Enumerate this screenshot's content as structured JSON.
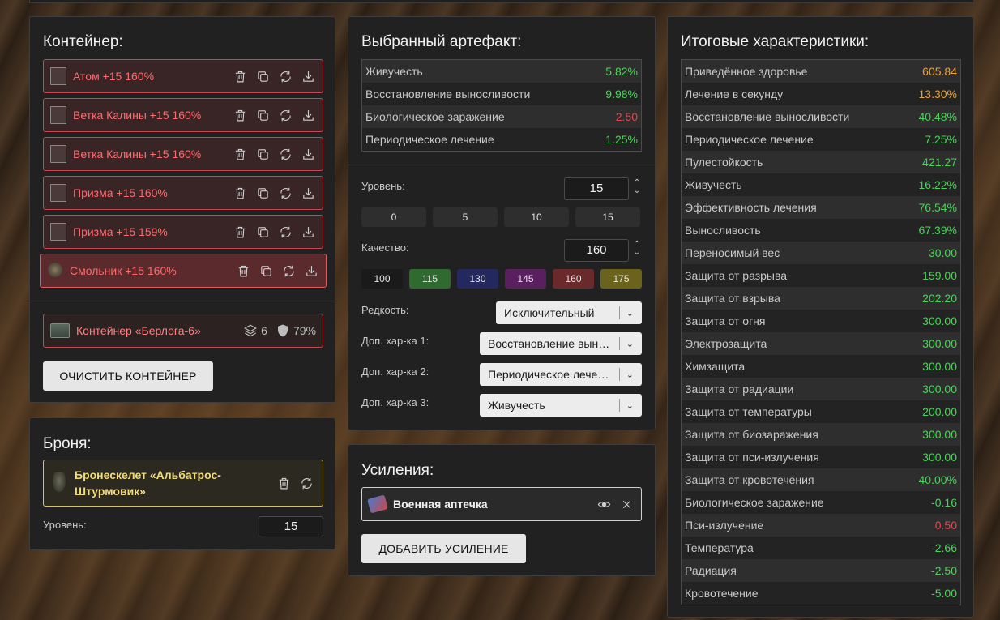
{
  "container": {
    "title": "Контейнер:",
    "artifacts": [
      {
        "name": "Атом +15 160%"
      },
      {
        "name": "Ветка Калины +15 160%"
      },
      {
        "name": "Ветка Калины +15 160%"
      },
      {
        "name": "Призма +15 160%"
      },
      {
        "name": "Призма +15 159%"
      },
      {
        "name": "Смольник +15 160%"
      }
    ],
    "box_name": "Контейнер «Берлога-6»",
    "slots": "6",
    "protection": "79%",
    "clear_label": "ОЧИСТИТЬ КОНТЕЙНЕР"
  },
  "armor": {
    "title": "Броня:",
    "name": "Бронескелет «Альбатрос-Штурмовик»",
    "level_label": "Уровень:",
    "level": "15"
  },
  "artifact": {
    "title": "Выбранный артефакт:",
    "stats": [
      {
        "label": "Живучесть",
        "value": "5.82%",
        "tone": "green"
      },
      {
        "label": "Восстановление выносливости",
        "value": "9.98%",
        "tone": "green"
      },
      {
        "label": "Биологическое заражение",
        "value": "2.50",
        "tone": "red"
      },
      {
        "label": "Периодическое лечение",
        "value": "1.25%",
        "tone": "green"
      }
    ],
    "level_label": "Уровень:",
    "level": "15",
    "level_presets": [
      "0",
      "5",
      "10",
      "15"
    ],
    "quality_label": "Качество:",
    "quality": "160",
    "quality_presets": [
      {
        "label": "100",
        "color": "#1a1a1a"
      },
      {
        "label": "115",
        "color": "#2f6b2f"
      },
      {
        "label": "130",
        "color": "#23285e"
      },
      {
        "label": "145",
        "color": "#5a1f5e"
      },
      {
        "label": "160",
        "color": "#6a2a2c"
      },
      {
        "label": "175",
        "color": "#6b621c"
      }
    ],
    "rarity_label": "Редкость:",
    "rarity": "Исключительный",
    "extra1_label": "Доп. хар-ка 1:",
    "extra1": "Восстановление выносливости",
    "extra2_label": "Доп. хар-ка 2:",
    "extra2": "Периодическое лечение",
    "extra3_label": "Доп. хар-ка 3:",
    "extra3": "Живучесть"
  },
  "boosts": {
    "title": "Усиления:",
    "item": "Военная аптечка",
    "add_label": "ДОБАВИТЬ УСИЛЕНИЕ"
  },
  "totals": {
    "title": "Итоговые характеристики:",
    "stats": [
      {
        "label": "Приведённое здоровье",
        "value": "605.84",
        "tone": "orange"
      },
      {
        "label": "Лечение в секунду",
        "value": "13.30%",
        "tone": "orange"
      },
      {
        "label": "Восстановление выносливости",
        "value": "40.48%",
        "tone": "green"
      },
      {
        "label": "Периодическое лечение",
        "value": "7.25%",
        "tone": "green"
      },
      {
        "label": "Пулестойкость",
        "value": "421.27",
        "tone": "green"
      },
      {
        "label": "Живучесть",
        "value": "16.22%",
        "tone": "green"
      },
      {
        "label": "Эффективность лечения",
        "value": "76.54%",
        "tone": "green"
      },
      {
        "label": "Выносливость",
        "value": "67.39%",
        "tone": "green"
      },
      {
        "label": "Переносимый вес",
        "value": "30.00",
        "tone": "green"
      },
      {
        "label": "Защита от разрыва",
        "value": "159.00",
        "tone": "green"
      },
      {
        "label": "Защита от взрыва",
        "value": "202.20",
        "tone": "green"
      },
      {
        "label": "Защита от огня",
        "value": "300.00",
        "tone": "green"
      },
      {
        "label": "Электрозащита",
        "value": "300.00",
        "tone": "green"
      },
      {
        "label": "Химзащита",
        "value": "300.00",
        "tone": "green"
      },
      {
        "label": "Защита от радиации",
        "value": "300.00",
        "tone": "green"
      },
      {
        "label": "Защита от температуры",
        "value": "200.00",
        "tone": "green"
      },
      {
        "label": "Защита от биозаражения",
        "value": "300.00",
        "tone": "green"
      },
      {
        "label": "Защита от пси-излучения",
        "value": "300.00",
        "tone": "green"
      },
      {
        "label": "Защита от кровотечения",
        "value": "40.00%",
        "tone": "green"
      },
      {
        "label": "Биологическое заражение",
        "value": "-0.16",
        "tone": "green"
      },
      {
        "label": "Пси-излучение",
        "value": "0.50",
        "tone": "red"
      },
      {
        "label": "Температура",
        "value": "-2.66",
        "tone": "green"
      },
      {
        "label": "Радиация",
        "value": "-2.50",
        "tone": "green"
      },
      {
        "label": "Кровотечение",
        "value": "-5.00",
        "tone": "green"
      }
    ]
  }
}
